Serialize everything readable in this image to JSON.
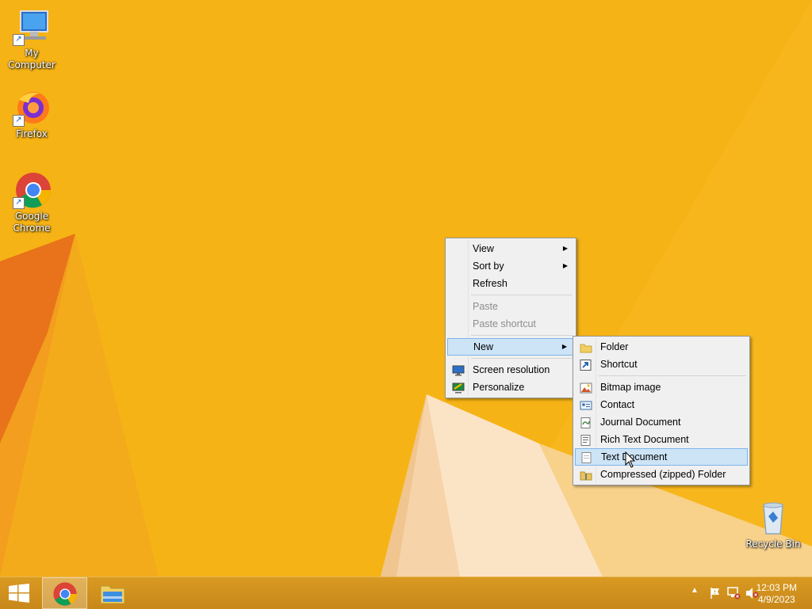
{
  "desktop": {
    "icons": [
      {
        "label": "My Computer",
        "icon": "computer-icon"
      },
      {
        "label": "Firefox",
        "icon": "firefox-icon"
      },
      {
        "label": "Google Chrome",
        "icon": "chrome-icon"
      },
      {
        "label": "Recycle Bin",
        "icon": "recycle-bin-icon"
      }
    ]
  },
  "context_menu": {
    "items": [
      {
        "label": "View",
        "submenu": true,
        "disabled": false
      },
      {
        "label": "Sort by",
        "submenu": true,
        "disabled": false
      },
      {
        "label": "Refresh",
        "submenu": false,
        "disabled": false
      },
      {
        "label": "Paste",
        "submenu": false,
        "disabled": true
      },
      {
        "label": "Paste shortcut",
        "submenu": false,
        "disabled": true
      },
      {
        "label": "New",
        "submenu": true,
        "disabled": false,
        "active": true
      },
      {
        "label": "Screen resolution",
        "submenu": false,
        "disabled": false,
        "icon": "display-icon"
      },
      {
        "label": "Personalize",
        "submenu": false,
        "disabled": false,
        "icon": "personalize-icon"
      }
    ]
  },
  "new_submenu": {
    "items": [
      {
        "label": "Folder",
        "icon": "folder-icon"
      },
      {
        "label": "Shortcut",
        "icon": "shortcut-icon"
      },
      {
        "label": "Bitmap image",
        "icon": "bitmap-icon"
      },
      {
        "label": "Contact",
        "icon": "contact-icon"
      },
      {
        "label": "Journal Document",
        "icon": "journal-icon"
      },
      {
        "label": "Rich Text Document",
        "icon": "rich-text-icon"
      },
      {
        "label": "Text Document",
        "icon": "text-document-icon",
        "hovered": true
      },
      {
        "label": "Compressed (zipped) Folder",
        "icon": "zip-folder-icon"
      }
    ]
  },
  "taskbar": {
    "pinned": [
      "chrome-icon",
      "file-explorer-icon"
    ],
    "tray": {
      "time": "12:03 PM",
      "date": "4/9/2023"
    }
  },
  "colors": {
    "wallpaper": "#f6b315",
    "menu_bg": "#f0f0f0",
    "highlight": "#cde4f7",
    "taskbar": "#c8881a"
  }
}
